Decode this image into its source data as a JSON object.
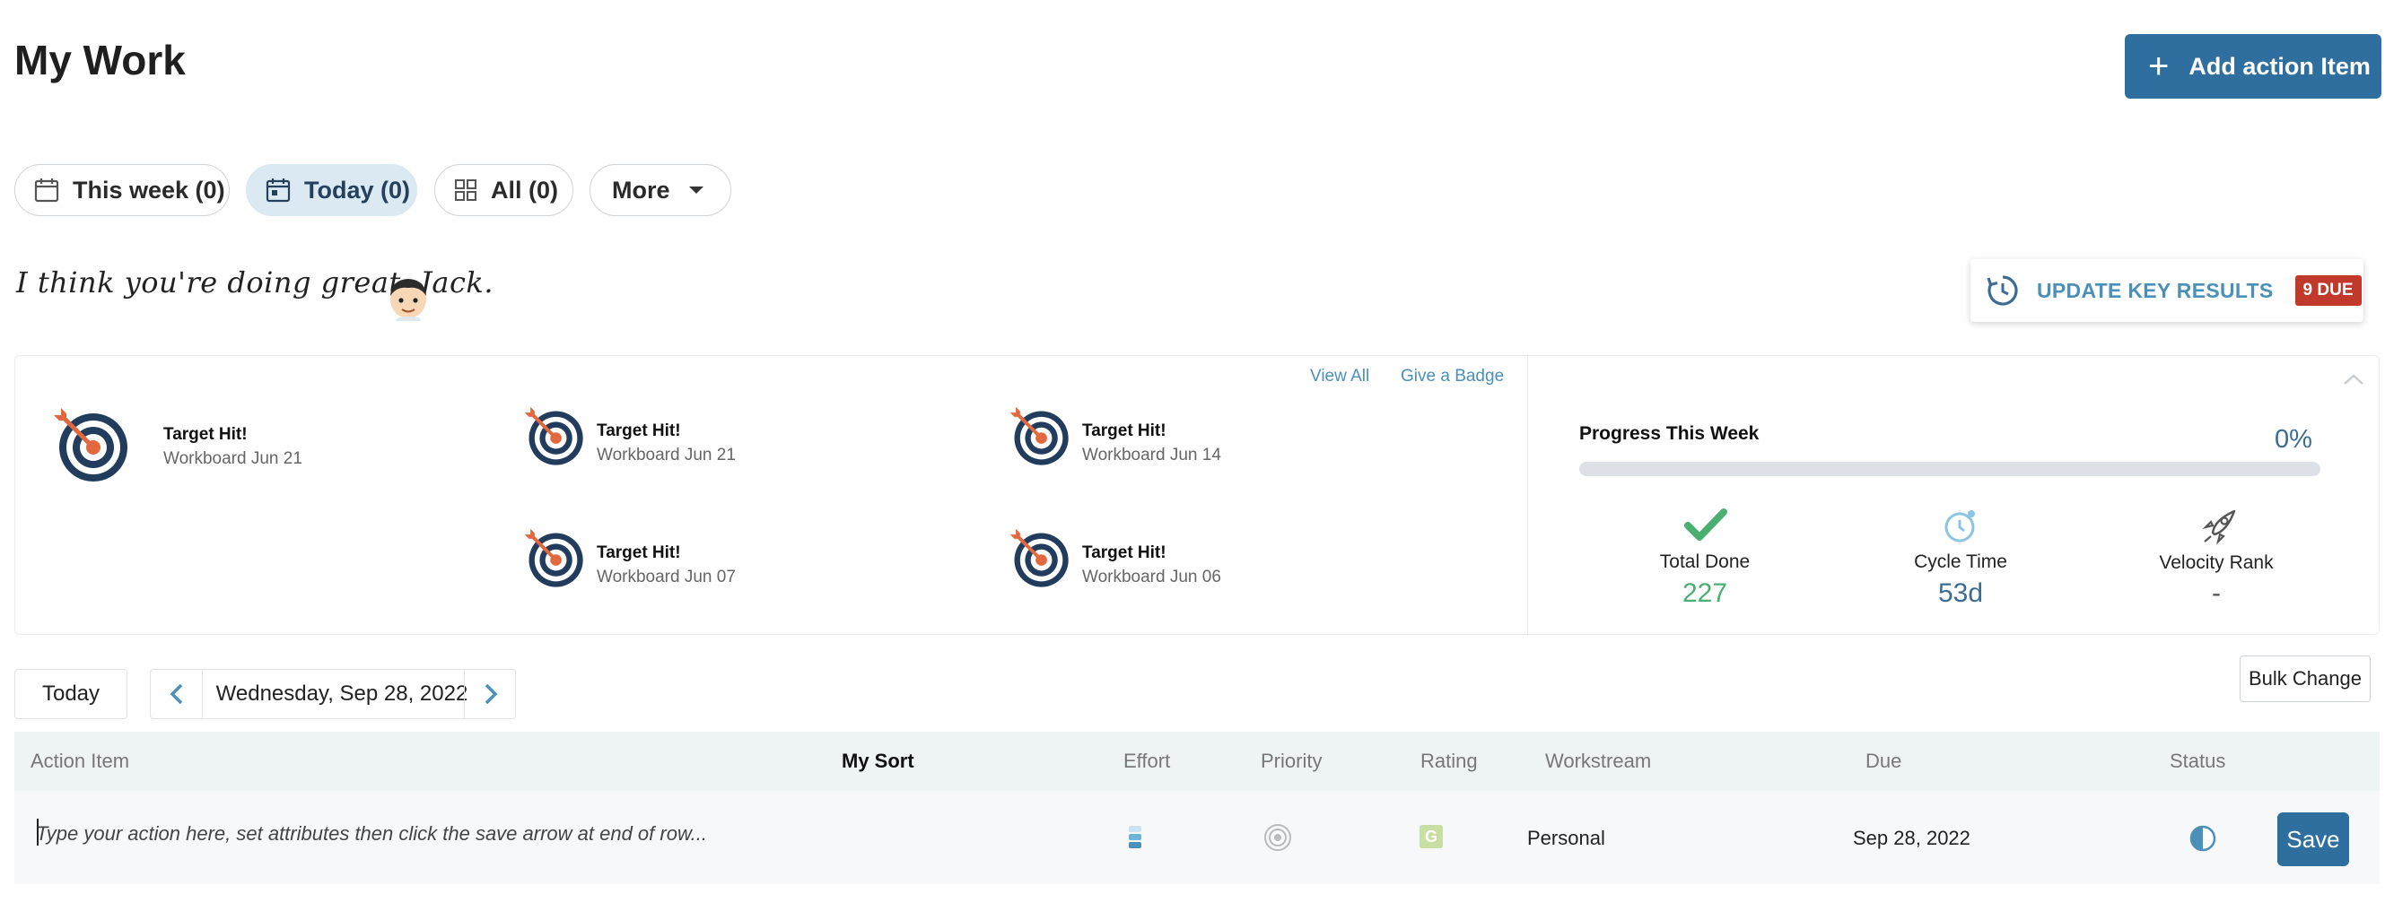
{
  "header": {
    "title": "My Work",
    "add_button_label": "Add action Item"
  },
  "filters": [
    {
      "label": "This week (0)",
      "icon": "calendar-icon"
    },
    {
      "label": "Today (0)",
      "icon": "calendar-day-icon",
      "active": true
    },
    {
      "label": "All (0)",
      "icon": "grid-icon"
    },
    {
      "label": "More",
      "icon": "caret-down-icon"
    }
  ],
  "greeting": "I think you're doing great, Jack.",
  "update_key_results": {
    "label": "UPDATE KEY RESULTS",
    "due_badge": "9 DUE"
  },
  "badges": {
    "view_all": "View All",
    "give_badge": "Give a Badge",
    "items": [
      {
        "title": "Target Hit!",
        "subtitle": "Workboard Jun 21"
      },
      {
        "title": "Target Hit!",
        "subtitle": "Workboard Jun 21"
      },
      {
        "title": "Target Hit!",
        "subtitle": "Workboard Jun 14"
      },
      {
        "title": "Target Hit!",
        "subtitle": "Workboard Jun 07"
      },
      {
        "title": "Target Hit!",
        "subtitle": "Workboard Jun 06"
      }
    ]
  },
  "progress": {
    "label": "Progress This Week",
    "percent_text": "0%",
    "percent": 0,
    "stats": [
      {
        "label": "Total Done",
        "value": "227",
        "icon": "checkmark-icon",
        "color": "#4caf72"
      },
      {
        "label": "Cycle Time",
        "value": "53d",
        "icon": "clock-icon",
        "color": "#3c6c93"
      },
      {
        "label": "Velocity Rank",
        "value": "-",
        "icon": "rocket-icon",
        "color": "#555555"
      }
    ]
  },
  "date_nav": {
    "today_label": "Today",
    "date": "Wednesday, Sep 28, 2022",
    "bulk_change_label": "Bulk Change"
  },
  "table": {
    "columns": {
      "action_item": "Action Item",
      "my_sort": "My Sort",
      "effort": "Effort",
      "priority": "Priority",
      "rating": "Rating",
      "workstream": "Workstream",
      "due": "Due",
      "status": "Status"
    },
    "new_row": {
      "placeholder": "Type your action here, set attributes then click the save arrow at end of row...",
      "rating": "G",
      "workstream": "Personal",
      "due": "Sep 28, 2022",
      "save_label": "Save"
    }
  },
  "colors": {
    "accent": "#2f6f9f",
    "link": "#4a90b8",
    "due_badge": "#c0392b",
    "table_header_bg": "#eef4f4"
  }
}
